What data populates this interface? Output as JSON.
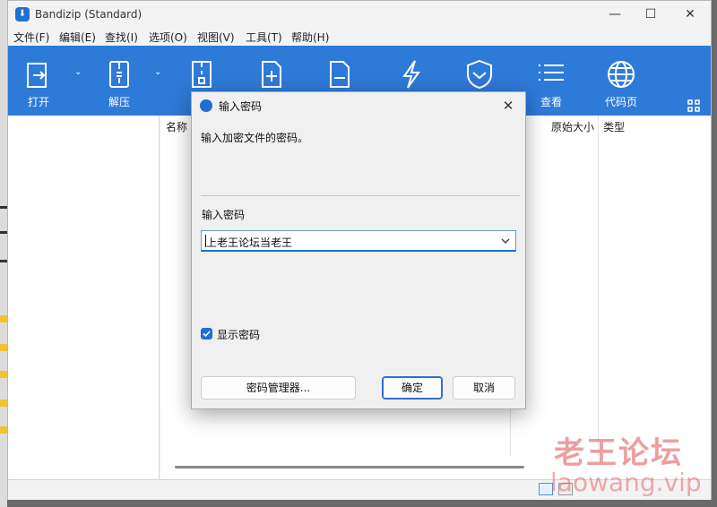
{
  "window": {
    "title": "Bandizip (Standard)",
    "controls": [
      "minimize",
      "maximize",
      "close"
    ]
  },
  "menu": [
    "文件(F)",
    "编辑(E)",
    "查找(I)",
    "选项(O)",
    "视图(V)",
    "工具(T)",
    "帮助(H)"
  ],
  "toolbar": {
    "background": "#2e7ad8",
    "buttons": [
      {
        "label": "打开",
        "icon": "open-archive-icon",
        "has_dropdown": true
      },
      {
        "label": "解压",
        "icon": "extract-icon",
        "has_dropdown": true
      },
      {
        "label": "",
        "icon": "zip-file-icon"
      },
      {
        "label": "",
        "icon": "add-file-icon"
      },
      {
        "label": "",
        "icon": "delete-file-icon"
      },
      {
        "label": "",
        "icon": "test-lightning-icon"
      },
      {
        "label": "",
        "icon": "shield-check-icon"
      },
      {
        "label": "查看",
        "icon": "list-view-icon"
      },
      {
        "label": "代码页",
        "icon": "globe-icon"
      }
    ]
  },
  "file_list": {
    "columns": [
      "名称",
      "原始大小",
      "类型"
    ]
  },
  "dialog": {
    "title": "输入密码",
    "message": "输入加密文件的密码。",
    "password_label": "输入密码",
    "password_value": "上老王论坛当老王",
    "show_password_label": "显示密码",
    "show_password_checked": true,
    "buttons": {
      "manager": "密码管理器...",
      "ok": "确定",
      "cancel": "取消"
    }
  },
  "watermark": {
    "line1": "老王论坛",
    "line2": "laowang.vip"
  }
}
